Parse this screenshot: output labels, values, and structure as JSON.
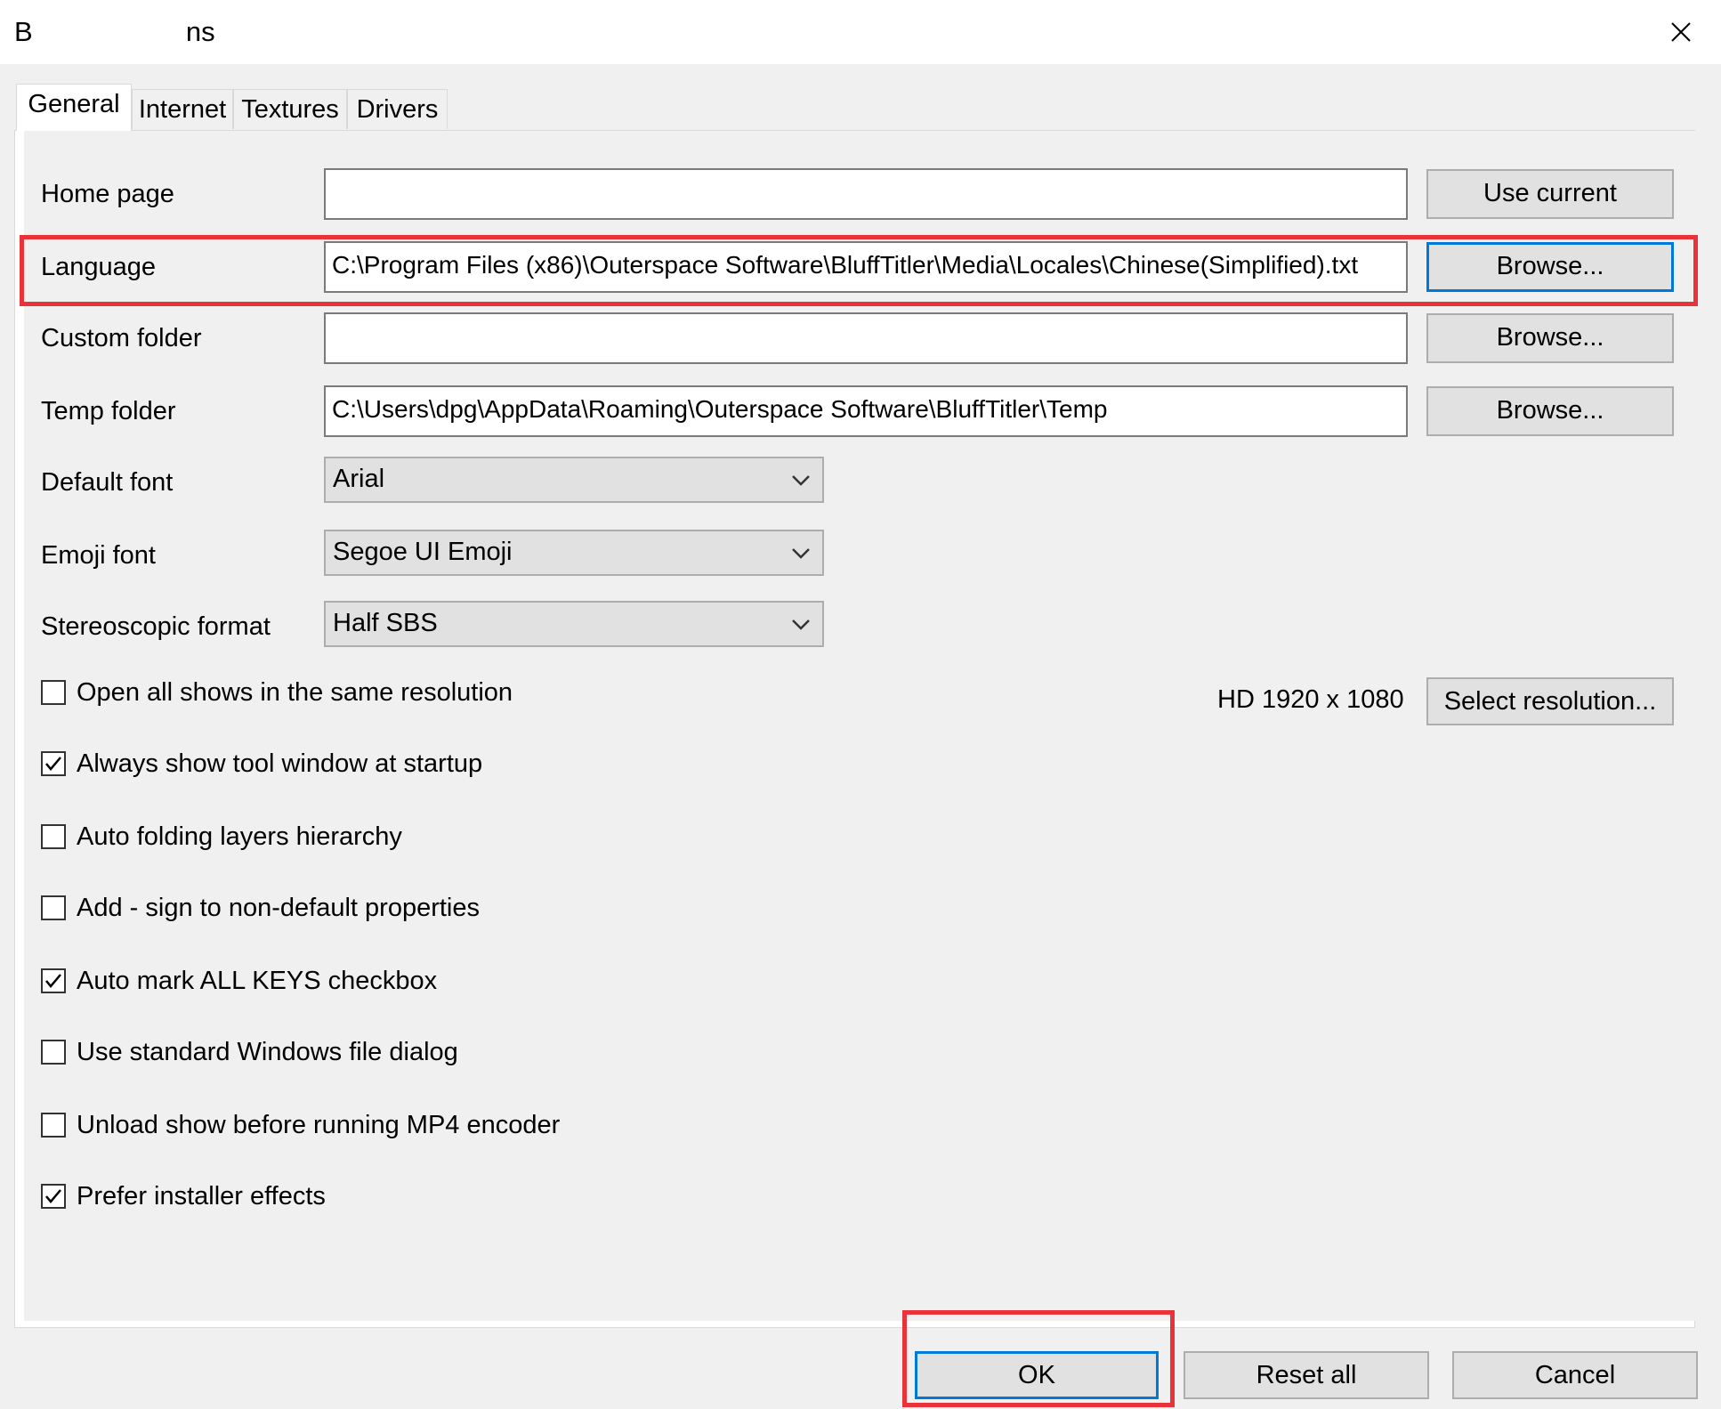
{
  "window": {
    "title": "B                    ns",
    "close_icon": "close-icon"
  },
  "tabs": [
    {
      "label": "General",
      "active": true
    },
    {
      "label": "Internet",
      "active": false
    },
    {
      "label": "Textures",
      "active": false
    },
    {
      "label": "Drivers",
      "active": false
    }
  ],
  "general": {
    "home_page": {
      "label": "Home page",
      "value": "",
      "button": "Use current"
    },
    "language": {
      "label": "Language",
      "value": "C:\\Program Files (x86)\\Outerspace Software\\BluffTitler\\Media\\Locales\\Chinese(Simplified).txt",
      "button": "Browse..."
    },
    "custom_folder": {
      "label": "Custom folder",
      "value": "",
      "button": "Browse..."
    },
    "temp_folder": {
      "label": "Temp folder",
      "value": "C:\\Users\\dpg\\AppData\\Roaming\\Outerspace Software\\BluffTitler\\Temp",
      "button": "Browse..."
    },
    "default_font": {
      "label": "Default font",
      "value": "Arial"
    },
    "emoji_font": {
      "label": "Emoji font",
      "value": "Segoe UI Emoji"
    },
    "stereoscopic_format": {
      "label": "Stereoscopic format",
      "value": "Half SBS"
    },
    "resolution": {
      "value": "HD 1920 x 1080",
      "button": "Select resolution..."
    },
    "checkboxes": [
      {
        "label": "Open all shows in the same resolution",
        "checked": false
      },
      {
        "label": "Always show tool window at startup",
        "checked": true
      },
      {
        "label": "Auto folding layers hierarchy",
        "checked": false
      },
      {
        "label": "Add - sign to non-default properties",
        "checked": false
      },
      {
        "label": "Auto mark ALL KEYS checkbox",
        "checked": true
      },
      {
        "label": "Use standard Windows file dialog",
        "checked": false
      },
      {
        "label": "Unload show before running MP4 encoder",
        "checked": false
      },
      {
        "label": "Prefer installer effects",
        "checked": true
      }
    ]
  },
  "footer": {
    "ok": "OK",
    "reset_all": "Reset all",
    "cancel": "Cancel"
  },
  "colors": {
    "highlight": "#e8333a",
    "focus": "#0078d7",
    "button_bg": "#e1e1e1",
    "dialog_bg": "#f0f0f0"
  }
}
